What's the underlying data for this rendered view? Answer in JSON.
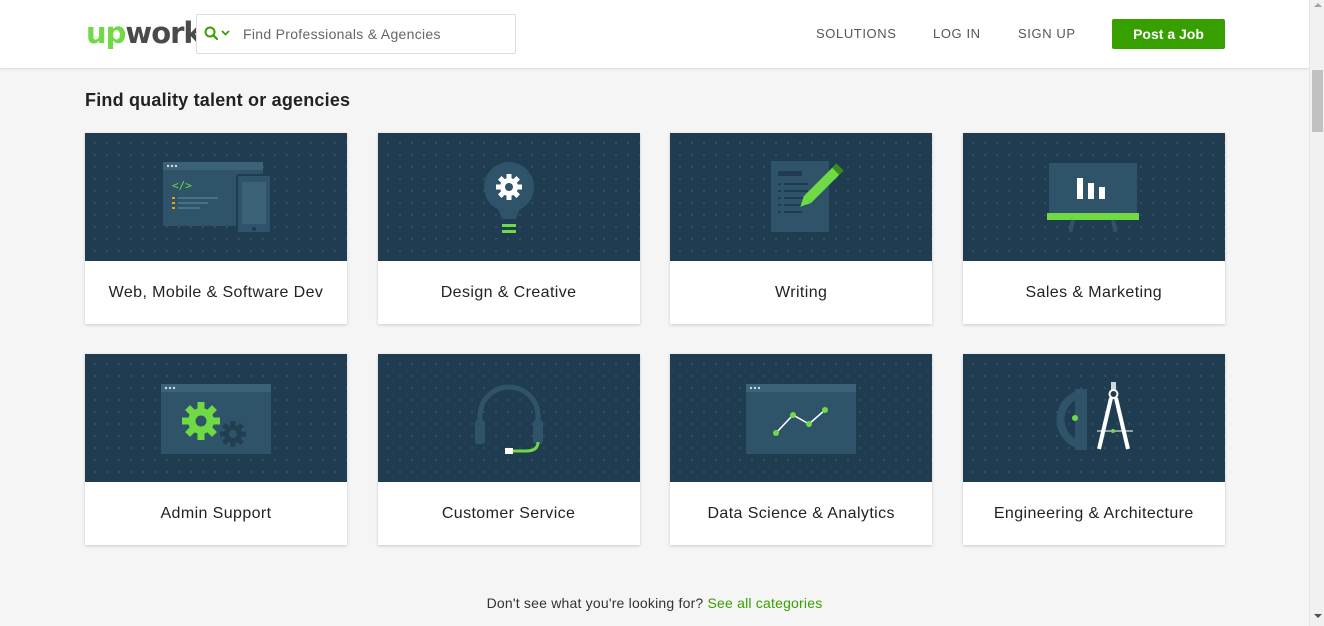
{
  "header": {
    "logo_up": "up",
    "logo_work": "work",
    "search_placeholder": "Find Professionals & Agencies",
    "nav": [
      "SOLUTIONS",
      "LOG IN",
      "SIGN UP"
    ],
    "post_job": "Post a Job"
  },
  "main": {
    "title": "Find quality talent or agencies",
    "categories": [
      {
        "label": "Web, Mobile & Software Dev",
        "icon": "code-window-phone-icon"
      },
      {
        "label": "Design & Creative",
        "icon": "lightbulb-gear-icon"
      },
      {
        "label": "Writing",
        "icon": "document-pen-icon"
      },
      {
        "label": "Sales & Marketing",
        "icon": "presentation-board-icon"
      },
      {
        "label": "Admin Support",
        "icon": "gears-window-icon"
      },
      {
        "label": "Customer Service",
        "icon": "headset-icon"
      },
      {
        "label": "Data Science & Analytics",
        "icon": "line-chart-icon"
      },
      {
        "label": "Engineering & Architecture",
        "icon": "compass-protractor-icon"
      }
    ]
  },
  "footer": {
    "prompt": "Don't see what you're looking for?",
    "link": "See all categories"
  },
  "colors": {
    "brand_green": "#6fda44",
    "button_green": "#37a000",
    "card_art_bg": "#1f3c50"
  }
}
